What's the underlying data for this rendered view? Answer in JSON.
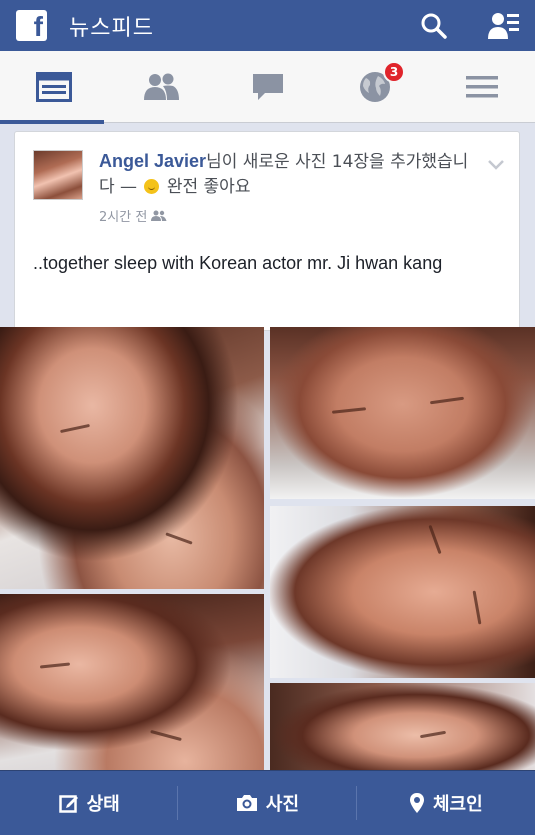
{
  "header": {
    "logo": "f",
    "title": "뉴스피드",
    "icons": [
      "search-icon",
      "friend-requests-icon"
    ]
  },
  "tabs": [
    {
      "name": "news-feed",
      "icon": "news-feed-icon",
      "active": true
    },
    {
      "name": "friends",
      "icon": "friends-icon"
    },
    {
      "name": "messages",
      "icon": "chat-icon"
    },
    {
      "name": "notifications",
      "icon": "globe-icon",
      "badge": "3"
    },
    {
      "name": "more",
      "icon": "menu-icon"
    }
  ],
  "post": {
    "author": "Angel Javier",
    "action": "님이 새로운 사진 14장을 추가했습니다 — ",
    "feeling": "완전 좋아요",
    "time": "2시간 전",
    "text": "..together sleep with Korean actor mr. Ji hwan kang"
  },
  "photos": [
    {
      "name": "photo-1"
    },
    {
      "name": "photo-2"
    },
    {
      "name": "photo-3"
    },
    {
      "name": "photo-4"
    },
    {
      "name": "photo-5"
    }
  ],
  "bottom_bar": {
    "status_label": "상태",
    "photo_label": "사진",
    "checkin_label": "체크인"
  },
  "colors": {
    "brand": "#3b5998",
    "badge": "#e0242b",
    "background": "#dfe3ee"
  }
}
